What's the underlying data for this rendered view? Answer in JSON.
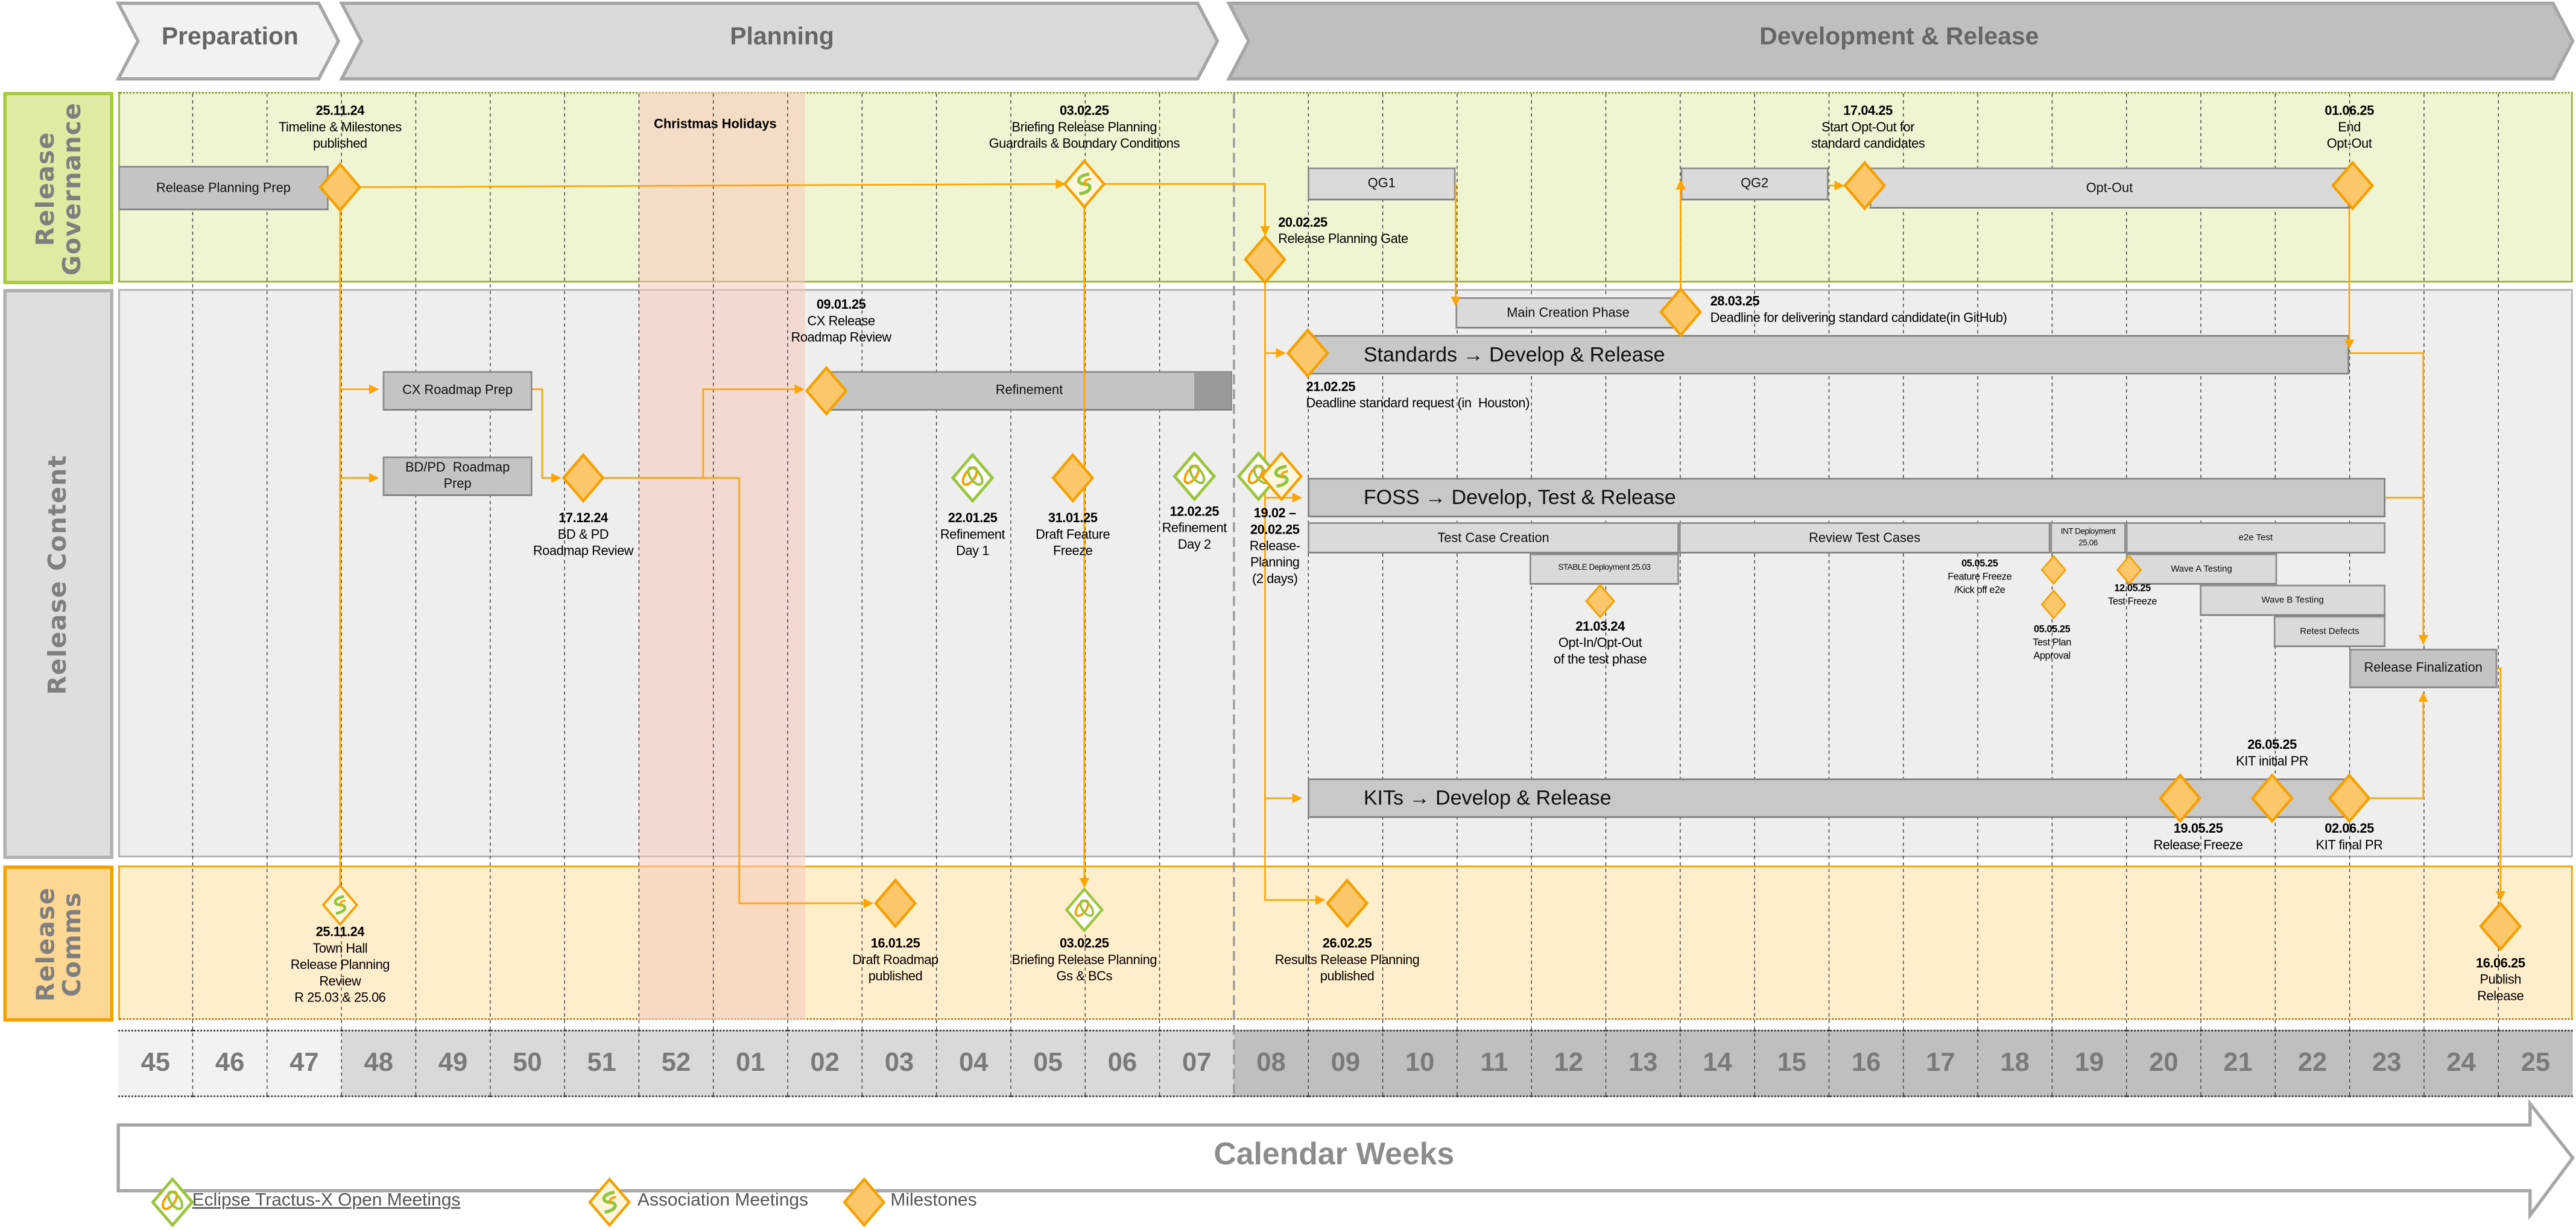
{
  "phases": [
    {
      "label": "Preparation"
    },
    {
      "label": "Planning"
    },
    {
      "label": "Development & Release"
    }
  ],
  "lanes": {
    "governance": "Release\nGovernance",
    "content": "Release Content",
    "comms": "Release\nComms"
  },
  "holiday_label": "Christmas Holidays",
  "weeks": [
    "45",
    "46",
    "47",
    "48",
    "49",
    "50",
    "51",
    "52",
    "01",
    "02",
    "03",
    "04",
    "05",
    "06",
    "07",
    "08",
    "09",
    "10",
    "11",
    "12",
    "13",
    "14",
    "15",
    "16",
    "17",
    "18",
    "19",
    "20",
    "21",
    "22",
    "23",
    "24",
    "25"
  ],
  "axis_label": "Calendar Weeks",
  "bars": [
    {
      "label": "Release Planning Prep"
    },
    {
      "label": "QG1"
    },
    {
      "label": "QG2"
    },
    {
      "label": "Opt-Out"
    },
    {
      "label": "CX Roadmap Prep"
    },
    {
      "label": "BD/PD  Roadmap\nPrep"
    },
    {
      "label": "Refinement"
    },
    {
      "label": "Main Creation Phase"
    },
    {
      "label": "Standards → Develop & Release"
    },
    {
      "label": "FOSS → Develop, Test & Release"
    },
    {
      "label": "Test Case Creation"
    },
    {
      "label": "Review Test Cases"
    },
    {
      "label": "INT Deployment\n25.06"
    },
    {
      "label": "e2e Test"
    },
    {
      "label": "STABLE Deployment 25.03"
    },
    {
      "label": "Wave A Testing"
    },
    {
      "label": "Wave B Testing"
    },
    {
      "label": "Retest Defects"
    },
    {
      "label": "Release Finalization"
    },
    {
      "label": "KITs → Develop & Release"
    }
  ],
  "markers": [
    {
      "kind": "milestone",
      "date": "25.11.24",
      "text": "Timeline & Milestones\npublished"
    },
    {
      "kind": "association",
      "date": "03.02.25",
      "text": "Briefing Release Planning\nGuardrails & Boundary Conditions"
    },
    {
      "kind": "milestone",
      "date": "20.02.25",
      "text": "Release Planning Gate"
    },
    {
      "kind": "milestone",
      "date": "17.04.25",
      "text": "Start Opt-Out for\nstandard candidates"
    },
    {
      "kind": "milestone",
      "date": "01.06.25",
      "text": "End\nOpt-Out"
    },
    {
      "kind": "milestone",
      "date": "09.01.25",
      "text": "CX Release\nRoadmap Review"
    },
    {
      "kind": "milestone",
      "date": "17.12.24",
      "text": "BD & PD\nRoadmap Review"
    },
    {
      "kind": "eclipse",
      "date": "22.01.25",
      "text": "Refinement\nDay 1"
    },
    {
      "kind": "milestone",
      "date": "31.01.25",
      "text": "Draft Feature\nFreeze"
    },
    {
      "kind": "eclipse",
      "date": "12.02.25",
      "text": "Refinement\nDay 2"
    },
    {
      "kind": "eclipse",
      "date": "",
      "text": ""
    },
    {
      "kind": "association",
      "date": "19.02 –\n20.02.25",
      "text": "Release-\nPlanning\n(2 days)"
    },
    {
      "kind": "milestone",
      "date": "28.03.25",
      "text": "Deadline for delivering standard candidate(in GitHub)"
    },
    {
      "kind": "milestone",
      "date": "21.02.25",
      "text": "Deadline standard request (in  Houston)"
    },
    {
      "kind": "milestone",
      "date": "21.03.24",
      "text": "Opt-In/Opt-Out\nof the test phase"
    },
    {
      "kind": "milestone",
      "date": "05.05.25",
      "text": "Feature Freeze\n/Kick off e2e"
    },
    {
      "kind": "milestone",
      "date": "05.05.25",
      "text": "Test Plan\nApproval"
    },
    {
      "kind": "milestone",
      "date": "12.05.25",
      "text": "Test Freeze"
    },
    {
      "kind": "milestone",
      "date": "19.05.25",
      "text": "Release Freeze"
    },
    {
      "kind": "milestone",
      "date": "26.05.25",
      "text": "KIT initial PR"
    },
    {
      "kind": "milestone",
      "date": "02.06.25",
      "text": "KIT final PR"
    },
    {
      "kind": "association",
      "date": "25.11.24",
      "text": "Town Hall\nRelease Planning\nReview\nR 25.03 & 25.06"
    },
    {
      "kind": "milestone",
      "date": "16.01.25",
      "text": "Draft Roadmap\npublished"
    },
    {
      "kind": "eclipse",
      "date": "03.02.25",
      "text": "Briefing Release Planning\nGs & BCs"
    },
    {
      "kind": "milestone",
      "date": "26.02.25",
      "text": "Results Release Planning\npublished"
    },
    {
      "kind": "milestone",
      "date": "16.06.25",
      "text": "Publish\nRelease"
    }
  ],
  "legend": [
    {
      "kind": "eclipse",
      "label": "Eclipse Tractus-X Open Meetings",
      "link": true
    },
    {
      "kind": "association",
      "label": "Association Meetings"
    },
    {
      "kind": "milestone",
      "label": "Milestones"
    }
  ],
  "colors": {
    "connector": "#ffa500",
    "milestone_fill": "#fcc76a",
    "milestone_stroke": "#f5a000",
    "eclipse_green": "#9bc53d",
    "governance_bg": "#eff5d2",
    "content_bg": "#eeeeee",
    "comms_bg": "#ffeecc",
    "holiday_bg": "#f8d7cf"
  }
}
